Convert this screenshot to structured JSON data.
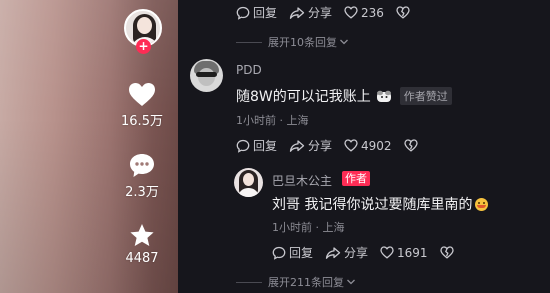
{
  "sidebar": {
    "likes": "16.5万",
    "comments": "2.3万",
    "favorites": "4487"
  },
  "actions": {
    "reply": "回复",
    "share": "分享"
  },
  "top_comment": {
    "like_count": "236",
    "expand_text": "展开10条回复"
  },
  "pdd_comment": {
    "username": "PDD",
    "text": "随8W的可以记我账上",
    "liked_badge": "作者赞过",
    "time": "1小时前",
    "location": "上海",
    "like_count": "4902"
  },
  "reply_comment": {
    "username": "巴旦木公主",
    "author_badge": "作者",
    "text": "刘哥 我记得你说过要随库里南的",
    "time": "1小时前",
    "location": "上海",
    "like_count": "1691"
  },
  "expand_more": "展开211条回复",
  "colors": {
    "accent": "#fe2c55",
    "panel_bg": "#16161c",
    "muted_text": "#8b8b93"
  }
}
